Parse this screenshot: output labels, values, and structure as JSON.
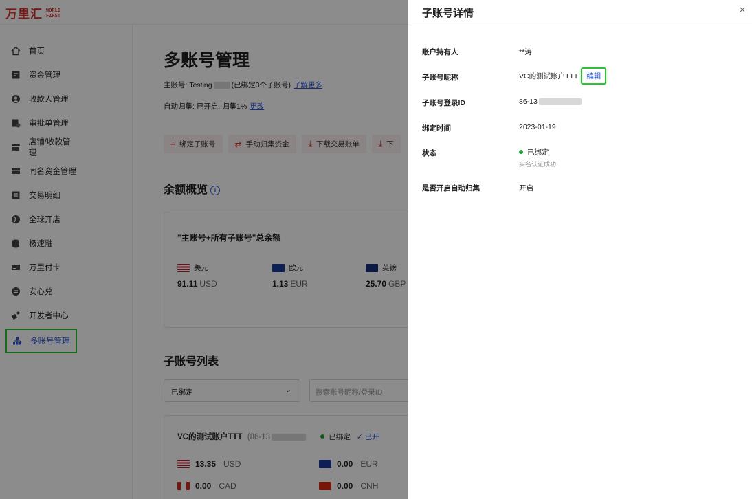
{
  "brand": {
    "name_cn": "万里汇",
    "name_en_1": "WORLD",
    "name_en_2": "FIRST"
  },
  "sidebar": {
    "items": [
      {
        "label": "首页",
        "icon": "home-icon"
      },
      {
        "label": "资金管理",
        "icon": "funds-icon"
      },
      {
        "label": "收款人管理",
        "icon": "payee-icon"
      },
      {
        "label": "审批单管理",
        "icon": "approval-icon"
      },
      {
        "label": "店铺/收款管理",
        "icon": "store-icon"
      },
      {
        "label": "同名资金管理",
        "icon": "card-icon"
      },
      {
        "label": "交易明细",
        "icon": "transactions-icon"
      },
      {
        "label": "全球开店",
        "icon": "globe-icon"
      },
      {
        "label": "极速融",
        "icon": "finance-icon"
      },
      {
        "label": "万里付卡",
        "icon": "wallet-card-icon"
      },
      {
        "label": "安心兑",
        "icon": "exchange-icon"
      },
      {
        "label": "开发者中心",
        "icon": "developer-icon"
      },
      {
        "label": "多账号管理",
        "icon": "accounts-icon",
        "active": true
      }
    ]
  },
  "main": {
    "title": "多账号管理",
    "main_account_label": "主账号: Testing",
    "bound_info": "(已绑定3个子账号)",
    "learn_more": "了解更多",
    "auto_collect": "自动归集: 已开启, 归集1%",
    "change": "更改",
    "actions": [
      "绑定子账号",
      "手动归集资金",
      "下载交易账单",
      "下"
    ],
    "balance_title": "余额概览",
    "balance_card_title": "\"主账号+所有子账号\"总余额",
    "balances": [
      {
        "currency": "美元",
        "amount": "91.11",
        "code": "USD"
      },
      {
        "currency": "欧元",
        "amount": "1.13",
        "code": "EUR"
      },
      {
        "currency": "英镑",
        "amount": "25.70",
        "code": "GBP"
      }
    ],
    "sub_list_title": "子账号列表",
    "filter_value": "已绑定",
    "search_placeholder": "搜索账号昵称/登录ID",
    "sub_card": {
      "name": "VC的测试账户TTT",
      "id": "(86-13",
      "status": "已绑定",
      "status2": "已开",
      "balances": [
        {
          "amount": "13.35",
          "code": "USD"
        },
        {
          "amount": "0.00",
          "code": "EUR"
        },
        {
          "amount": "0.00",
          "code": "CAD"
        },
        {
          "amount": "0.00",
          "code": "CNH"
        }
      ]
    }
  },
  "drawer": {
    "title": "子账号详情",
    "rows": {
      "holder": {
        "label": "账户持有人",
        "value": "**涛"
      },
      "nickname": {
        "label": "子账号昵称",
        "value": "VC的测试账户TTT",
        "edit": "编辑"
      },
      "login_id": {
        "label": "子账号登录ID",
        "value": "86-13"
      },
      "bind_time": {
        "label": "绑定时间",
        "value": "2023-01-19"
      },
      "status": {
        "label": "状态",
        "value": "已绑定",
        "note": "实名认证成功"
      },
      "auto": {
        "label": "是否开启自动归集",
        "value": "开启"
      }
    }
  },
  "colors": {
    "brand_red": "#e0312c",
    "link_blue": "#2a56d6",
    "highlight_green": "#2fbf3a",
    "status_green": "#1fa33a"
  }
}
